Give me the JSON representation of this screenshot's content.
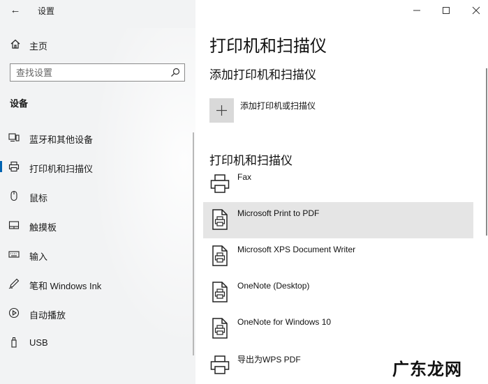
{
  "window": {
    "title": "设置",
    "back_icon": "back-arrow-icon",
    "controls": [
      "minimize-icon",
      "maximize-icon",
      "close-icon"
    ]
  },
  "sidebar": {
    "home_label": "主页",
    "search_placeholder": "查找设置",
    "section_title": "设备",
    "items": [
      {
        "label": "蓝牙和其他设备",
        "icon": "bluetooth-devices-icon"
      },
      {
        "label": "打印机和扫描仪",
        "icon": "printer-icon",
        "selected": true
      },
      {
        "label": "鼠标",
        "icon": "mouse-icon"
      },
      {
        "label": "触摸板",
        "icon": "touchpad-icon"
      },
      {
        "label": "输入",
        "icon": "keyboard-icon"
      },
      {
        "label": "笔和 Windows Ink",
        "icon": "pen-icon"
      },
      {
        "label": "自动播放",
        "icon": "autoplay-icon"
      },
      {
        "label": "USB",
        "icon": "usb-icon"
      }
    ]
  },
  "main": {
    "title": "打印机和扫描仪",
    "add_section_title": "添加打印机和扫描仪",
    "add_button_label": "添加打印机或扫描仪",
    "list_section_title": "打印机和扫描仪",
    "devices": [
      {
        "label": "Fax",
        "icon": "printer-icon"
      },
      {
        "label": "Microsoft Print to PDF",
        "icon": "document-printer-icon",
        "selected": true
      },
      {
        "label": "Microsoft XPS Document Writer",
        "icon": "document-printer-icon"
      },
      {
        "label": "OneNote (Desktop)",
        "icon": "document-printer-icon"
      },
      {
        "label": "OneNote for Windows 10",
        "icon": "document-printer-icon"
      },
      {
        "label": "导出为WPS PDF",
        "icon": "printer-icon"
      }
    ]
  },
  "watermark": "广东龙网",
  "colors": {
    "accent": "#0063b1",
    "sidebar_bg": "#f2f3f4",
    "selected_row": "#e5e5e5"
  }
}
